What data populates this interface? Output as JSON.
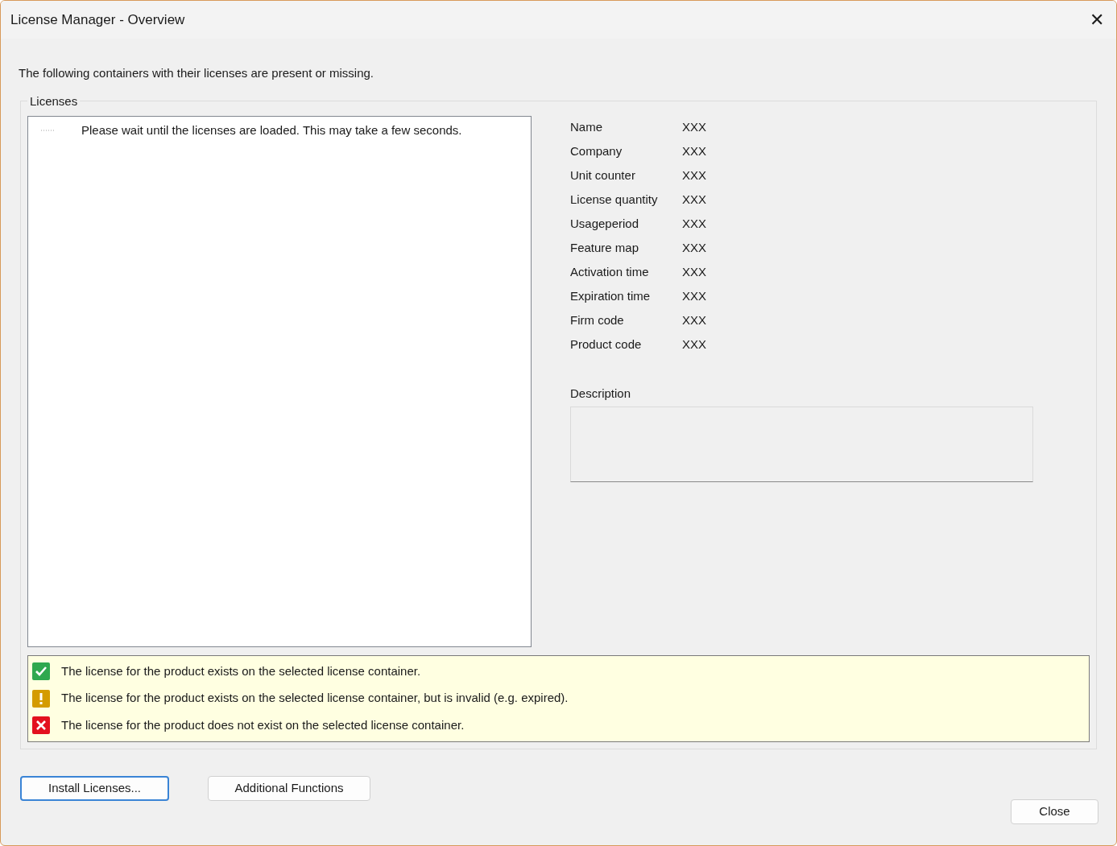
{
  "window": {
    "title": "License Manager - Overview",
    "close": "✕"
  },
  "intro": "The following containers with their licenses are present or missing.",
  "licenses": {
    "title": "Licenses",
    "tree": {
      "message": "Please wait until the licenses are loaded. This may take a few seconds."
    },
    "details": [
      {
        "label": "Name",
        "value": "XXX"
      },
      {
        "label": "Company",
        "value": "XXX"
      },
      {
        "label": "Unit counter",
        "value": "XXX"
      },
      {
        "label": "License quantity",
        "value": "XXX"
      },
      {
        "label": "Usageperiod",
        "value": "XXX"
      },
      {
        "label": "Feature map",
        "value": "XXX"
      },
      {
        "label": "Activation time",
        "value": "XXX"
      },
      {
        "label": "Expiration time",
        "value": "XXX"
      },
      {
        "label": "Firm code",
        "value": "XXX"
      },
      {
        "label": "Product code",
        "value": "XXX"
      }
    ],
    "description": {
      "label": "Description"
    },
    "legend": [
      {
        "kind": "ok",
        "text": "The license for the product exists on the selected license container."
      },
      {
        "kind": "warning",
        "text": "The license for the product exists on the selected license container, but is invalid (e.g. expired)."
      },
      {
        "kind": "error",
        "text": "The license for the product does not exist on the selected license container."
      }
    ]
  },
  "buttons": [
    {
      "label": "Install Licenses...",
      "focused": true
    },
    {
      "label": "Additional Functions",
      "focused": false
    }
  ],
  "close_button": {
    "label": "Close"
  }
}
